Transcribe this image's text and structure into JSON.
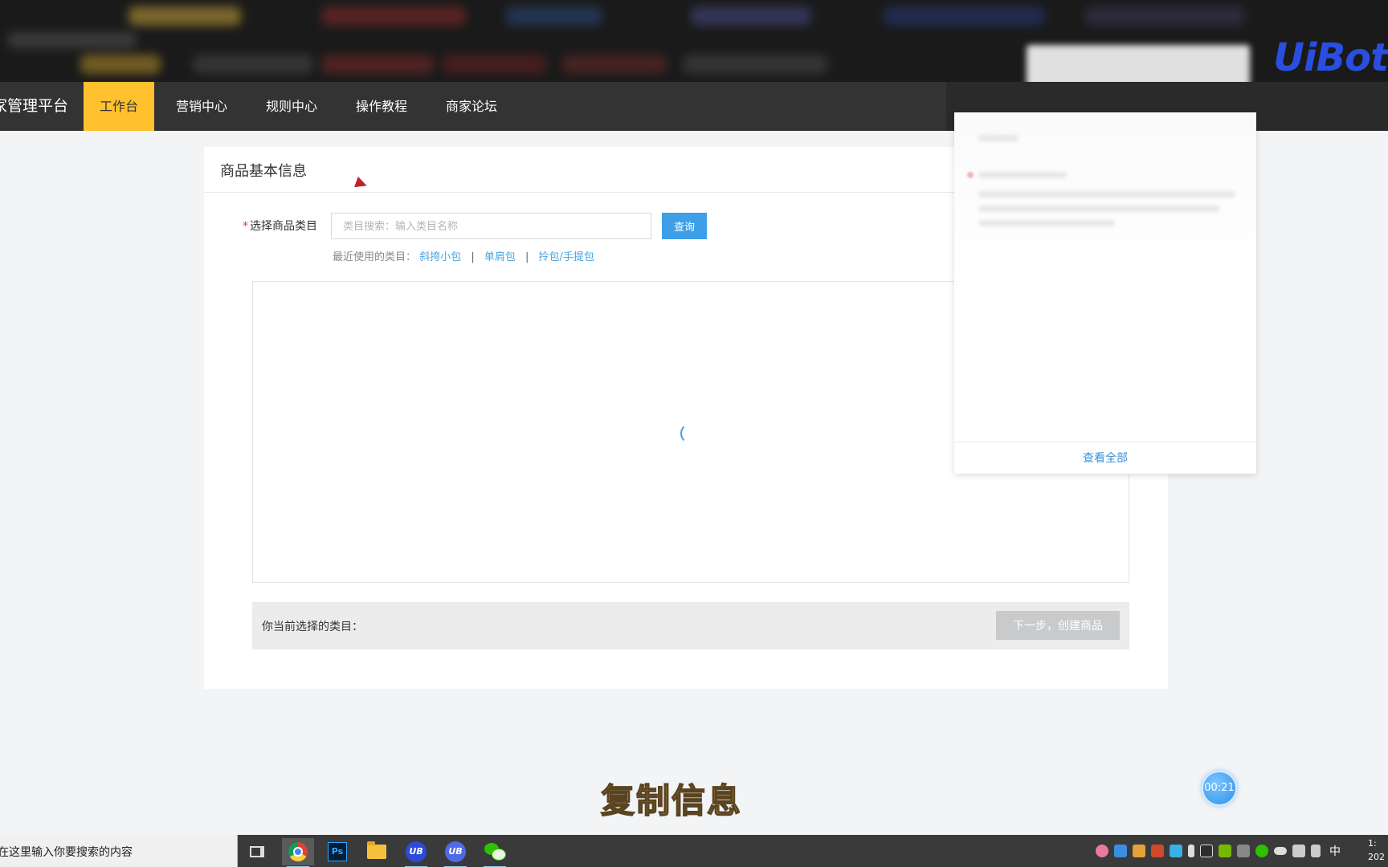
{
  "nav": {
    "brand": "家管理平台",
    "items": [
      {
        "label": "工作台",
        "active": true
      },
      {
        "label": "营销中心",
        "active": false
      },
      {
        "label": "规则中心",
        "active": false
      },
      {
        "label": "操作教程",
        "active": false
      },
      {
        "label": "商家论坛",
        "active": false
      }
    ],
    "active_color": "#ffc12d"
  },
  "brand_logo": "UiBot",
  "card": {
    "title": "商品基本信息",
    "category_field": {
      "required_mark": "*",
      "label": "选择商品类目",
      "placeholder": "类目搜索：输入类目名称",
      "value": "",
      "button": "查询"
    },
    "recent": {
      "label": "最近使用的类目：",
      "items": [
        "斜挎小包",
        "单肩包",
        "拎包/手提包"
      ],
      "separator": "|"
    },
    "loading": true,
    "selection_label": "你当前选择的类目：",
    "next_button": "下一步，创建商品"
  },
  "popup": {
    "view_all": "查看全部"
  },
  "subtitle": "复制信息",
  "timer": "00:21",
  "taskbar": {
    "search_text": "在这里输入你要搜索的内容",
    "apps": [
      "task-view",
      "chrome",
      "photoshop",
      "file-explorer",
      "uibot-creator",
      "uibot-worker",
      "wechat"
    ],
    "ime": "中",
    "clock_line1": "1:",
    "clock_line2": "202"
  },
  "colors": {
    "accent_blue": "#3d9fe8",
    "link_blue": "#4aa3e0",
    "required_red": "#e4393c"
  }
}
